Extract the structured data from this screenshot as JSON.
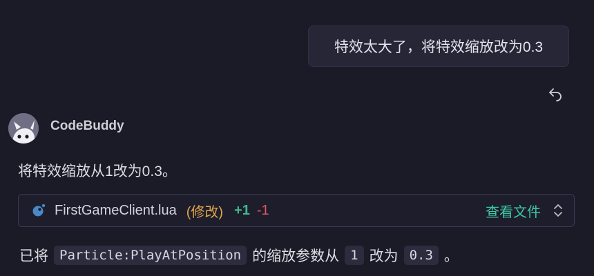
{
  "user_message": {
    "text": "特效太大了，将特效缩放改为0.3",
    "undo_icon": "undo-icon"
  },
  "assistant": {
    "name": "CodeBuddy",
    "avatar_icon": "robot-avatar",
    "reply": "将特效缩放从1改为0.3。"
  },
  "file_change": {
    "icon": "lua-file-icon",
    "file_name": "FirstGameClient.lua",
    "status": "(修改)",
    "additions": "+1",
    "deletions": "-1",
    "view_label": "查看文件",
    "expand_icon": "chevron-up-down-icon"
  },
  "summary": {
    "prefix": "已将",
    "code_function": "Particle:PlayAtPosition",
    "middle": "的缩放参数从",
    "code_old": "1",
    "connector": "改为",
    "code_new": "0.3",
    "suffix": "。"
  },
  "colors": {
    "background": "#1b1b27",
    "bubble": "#262637",
    "status_orange": "#e0a64a",
    "add_green": "#3fb98c",
    "delete_red": "#e05a5a",
    "link_teal": "#3ec9a3"
  }
}
